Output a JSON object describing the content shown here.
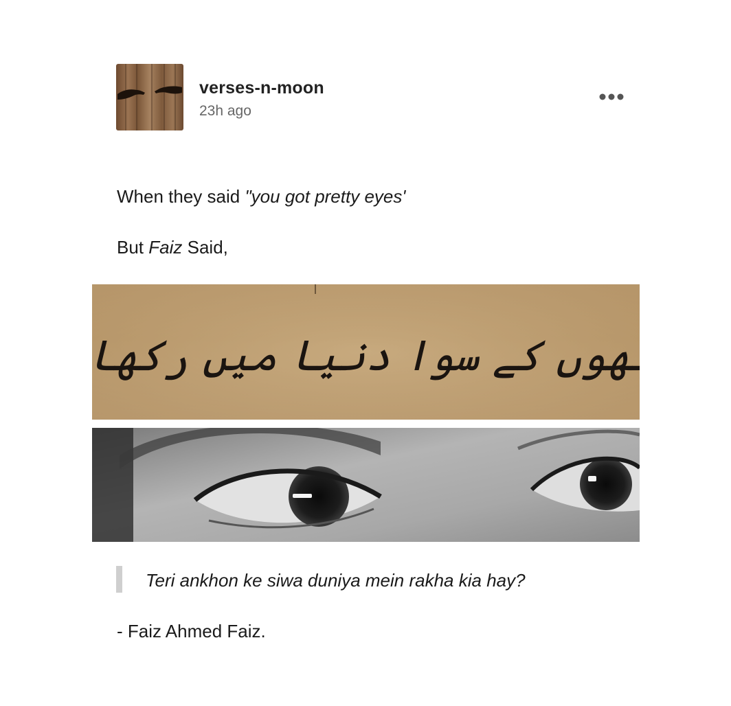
{
  "post": {
    "author": "verses-n-moon",
    "time_ago": "23h ago",
    "more_icon": "ellipsis-icon",
    "line1_prefix": "When they said",
    "line1_quote": "\"you got pretty eyes'",
    "line2_prefix": "But",
    "line2_name": "Faiz",
    "line2_suffix": "Said,",
    "urdu_verse": "تیری آنکھوں کے سوا دنیا میں رکھا کیا ہے؟",
    "quote": "Teri ankhon ke siwa duniya mein rakha kia hay?",
    "signature": "- Faiz Ahmed Faiz."
  },
  "colors": {
    "text": "#1a1a1a",
    "muted": "#666666",
    "quote_bar": "#cfcfcf",
    "paper": "#c4a57a"
  }
}
